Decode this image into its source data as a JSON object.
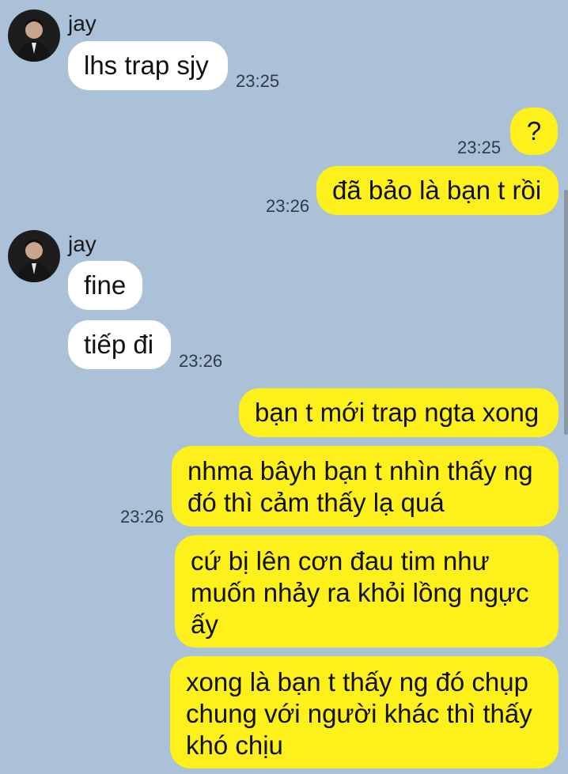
{
  "contact": {
    "name": "jay"
  },
  "messages": [
    {
      "id": "m1",
      "side": "left",
      "text": "lhs trap sjy",
      "time": "23:25"
    },
    {
      "id": "m2",
      "side": "right",
      "text": "?",
      "time": "23:25"
    },
    {
      "id": "m3",
      "side": "right",
      "text": "đã bảo là bạn t rồi",
      "time": "23:26"
    },
    {
      "id": "m4",
      "side": "left",
      "text": "fine",
      "time": ""
    },
    {
      "id": "m5",
      "side": "left",
      "text": "tiếp đi",
      "time": "23:26"
    },
    {
      "id": "m6",
      "side": "right",
      "text": "bạn t mới trap ngta xong",
      "time": ""
    },
    {
      "id": "m7",
      "side": "right",
      "text": "nhma bâyh bạn t nhìn thấy ng đó thì cảm thấy lạ quá",
      "time": "23:26"
    },
    {
      "id": "m8",
      "side": "right",
      "text": "cứ bị lên cơn đau tim như muốn nhảy ra khỏi lồng ngực ấy",
      "time": ""
    },
    {
      "id": "m9",
      "side": "right",
      "text": "xong là bạn t thấy ng đó chụp chung với người khác thì thấy khó chịu",
      "time": ""
    }
  ],
  "colors": {
    "background": "#abc1d7",
    "incoming_bubble": "#ffffff",
    "outgoing_bubble": "#fef01b"
  }
}
